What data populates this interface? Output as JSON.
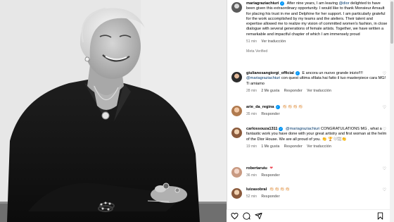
{
  "post": {
    "username": "mariagraziachiuri",
    "caption_parts": {
      "before_mention": "After nine years, I am leaving ",
      "mention": "@dior",
      "after_mention": " delighted to have been given this extraordinary opportunity. I would like to thank Monsieur Arnault for placing his trust in me and Delphine for her support. I am particularly grateful for the work accomplished by my teams and the ateliers. Their talent and expertise allowed me to realize my vision of committed women's fashion, in close dialogue with several generations of female artists. Together, we have written a remarkable and impactful chapter of which I am immensely proud"
    },
    "time": "51 min",
    "see_translation": "Ver traducción",
    "label": "Meta Verified"
  },
  "comments": [
    {
      "username": "giulianosangiorgi_official",
      "verified": true,
      "text_a": "E ancora un nuovo grande inizio!!!! ",
      "mention": "@mariagraziachiuri",
      "text_b": " con quest ultima sfilata hai fatto il tuo masterpiece cara MG! Ti amiamo",
      "time": "28 min",
      "likes": "2 Me gusta",
      "reply": "Responder",
      "translate": "Ver traducción"
    },
    {
      "username": "arie_da_regina",
      "verified": true,
      "text": "👏🏻👏🏻👏🏻👏🏻",
      "time": "35 min",
      "likes": "",
      "reply": "Responder",
      "translate": ""
    },
    {
      "username": "carlossouza1311",
      "verified": true,
      "mention": "@mariagraziachiuri",
      "text_b": " CONGRATULATIONS MG , what a fantastic work you have done with your great artistry and first woman at the helm of the Dior House. We are all proud of you. 👏 🏆🤍🏼👏",
      "time": "19 min",
      "likes": "1 Me gusta",
      "reply": "Responder",
      "translate": "Ver traducción"
    },
    {
      "username": "robertaruiu",
      "verified": false,
      "text": "❤",
      "time": "36 min",
      "likes": "",
      "reply": "Responder",
      "translate": ""
    },
    {
      "username": "luizasobral",
      "verified": false,
      "text": "👏🏻👏🏻👏🏻👏🏻",
      "time": "52 min",
      "likes": "",
      "reply": "Responder",
      "translate": ""
    }
  ],
  "icons": {
    "like": "heart-icon",
    "comment": "comment-icon",
    "share": "share-icon",
    "save": "bookmark-icon"
  },
  "colors": {
    "mention": "#00376b",
    "verified": "#0095f6",
    "meta": "#737373"
  }
}
